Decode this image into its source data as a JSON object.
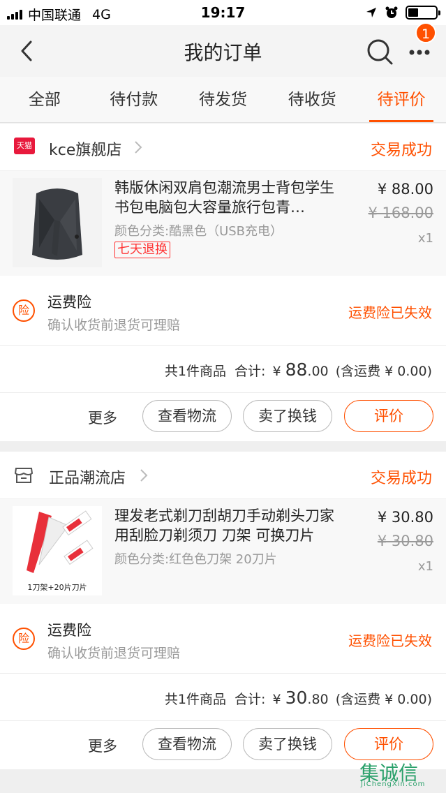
{
  "status_bar": {
    "carrier": "中国联通",
    "network": "4G",
    "time": "19:17"
  },
  "nav": {
    "title": "我的订单",
    "badge_count": "1"
  },
  "tabs": [
    {
      "label": "全部",
      "active": false
    },
    {
      "label": "待付款",
      "active": false
    },
    {
      "label": "待发货",
      "active": false
    },
    {
      "label": "待收货",
      "active": false
    },
    {
      "label": "待评价",
      "active": true
    }
  ],
  "orders": [
    {
      "shop_badge": "天猫",
      "shop_name": "kce旗舰店",
      "status": "交易成功",
      "item": {
        "title": "韩版休闲双肩包潮流男士背包学生书包电脑包大容量旅行包青…",
        "sku": "颜色分类:酷黑色（USB充电）",
        "tag": "七天退换",
        "price": "¥ 88.00",
        "original_price": "¥ 168.00",
        "qty": "x1"
      },
      "insurance": {
        "name": "运费险",
        "desc": "确认收货前退货可理赔",
        "status": "运费险已失效",
        "icon": "险"
      },
      "summary": {
        "count": "共1件商品",
        "total_label": "合计:",
        "currency": "¥",
        "amount_int": "88",
        "amount_dec": ".00",
        "shipping": "(含运费 ¥ 0.00)"
      },
      "actions": {
        "more": "更多",
        "logistics": "查看物流",
        "resell": "卖了换钱",
        "review": "评价"
      }
    },
    {
      "shop_name": "正品潮流店",
      "status": "交易成功",
      "item": {
        "title": "理发老式剃刀刮胡刀手动剃头刀家用刮脸刀剃须刀 刀架 可换刀片",
        "sku": "颜色分类:红色色刀架 20刀片",
        "image_caption": "1刀架+20片刀片",
        "price": "¥ 30.80",
        "original_price": "¥ 30.80",
        "qty": "x1"
      },
      "insurance": {
        "name": "运费险",
        "desc": "确认收货前退货可理赔",
        "status": "运费险已失效",
        "icon": "险"
      },
      "summary": {
        "count": "共1件商品",
        "total_label": "合计:",
        "currency": "¥",
        "amount_int": "30",
        "amount_dec": ".80",
        "shipping": "(含运费 ¥ 0.00)"
      },
      "actions": {
        "more": "更多",
        "logistics": "查看物流",
        "resell": "卖了换钱",
        "review": "评价"
      }
    }
  ],
  "watermark": {
    "text": "集诚信",
    "url": "JiChengXin.com"
  }
}
